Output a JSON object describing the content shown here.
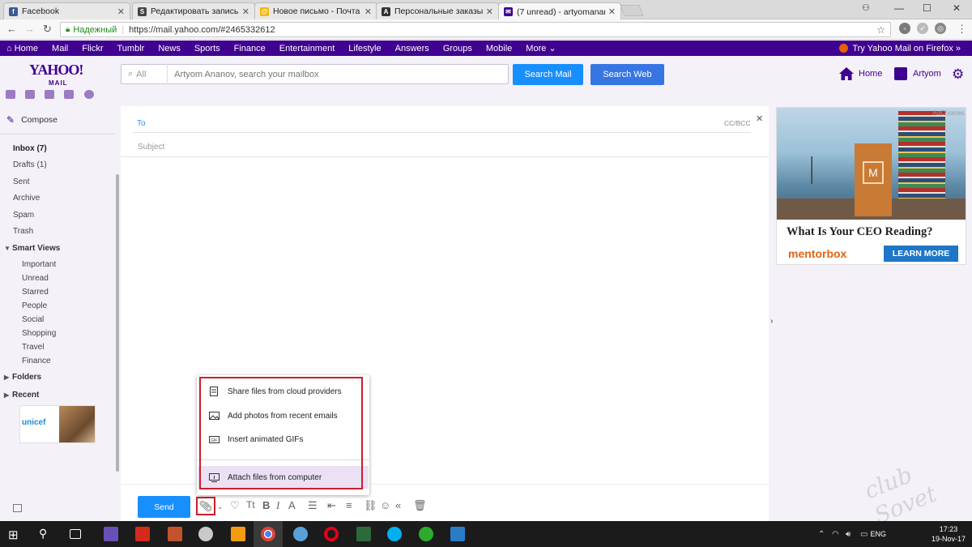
{
  "browser": {
    "tabs": [
      {
        "title": "Facebook",
        "color": "#3b5998",
        "glyph": "f"
      },
      {
        "title": "Редактировать запись «",
        "color": "#444444",
        "glyph": "S"
      },
      {
        "title": "Новое письмо - Почта I",
        "color": "#f5b400",
        "glyph": "@"
      },
      {
        "title": "Персональные заказы ,",
        "color": "#333333",
        "glyph": "A"
      },
      {
        "title": "(7 unread) - artyomanano",
        "color": "#400090",
        "glyph": "✉"
      }
    ],
    "secure_label": "Надежный",
    "url": "https://mail.yahoo.com/#2465332612"
  },
  "yahoo_nav": {
    "items": [
      "Home",
      "Mail",
      "Flickr",
      "Tumblr",
      "News",
      "Sports",
      "Finance",
      "Entertainment",
      "Lifestyle",
      "Answers",
      "Groups",
      "Mobile",
      "More ⌄"
    ],
    "firefox_promo": "Try Yahoo Mail on Firefox »"
  },
  "header": {
    "logo_top": "YAHOO!",
    "logo_bottom": "MAIL",
    "search_scope": "All",
    "search_placeholder": "Artyom Ananov, search your mailbox",
    "search_mail": "Search Mail",
    "search_web": "Search Web",
    "home": "Home",
    "user": "Artyom"
  },
  "sidebar": {
    "compose": "Compose",
    "folders": [
      "Inbox (7)",
      "Drafts (1)",
      "Sent",
      "Archive",
      "Spam",
      "Trash"
    ],
    "smart_views_label": "Smart Views",
    "smart_views": [
      "Important",
      "Unread",
      "Starred",
      "People",
      "Social",
      "Shopping",
      "Travel",
      "Finance"
    ],
    "folders_label": "Folders",
    "recent_label": "Recent",
    "unicef": "unicef"
  },
  "compose": {
    "to_label": "To",
    "ccbcc": "CC/BCC",
    "subject_placeholder": "Subject",
    "send": "Send",
    "attach_menu": [
      "Share files from cloud providers",
      "Add photos from recent emails",
      "Insert animated GIFs",
      "Attach files from computer"
    ]
  },
  "ad": {
    "choices": "AdChoices",
    "headline": "What Is Your CEO Reading?",
    "brand": "mentorbox",
    "cta": "LEARN MORE",
    "box_letter": "M"
  },
  "taskbar": {
    "lang": "ENG",
    "time": "17:23",
    "date": "19-Nov-17"
  },
  "watermark": "club Sovet"
}
